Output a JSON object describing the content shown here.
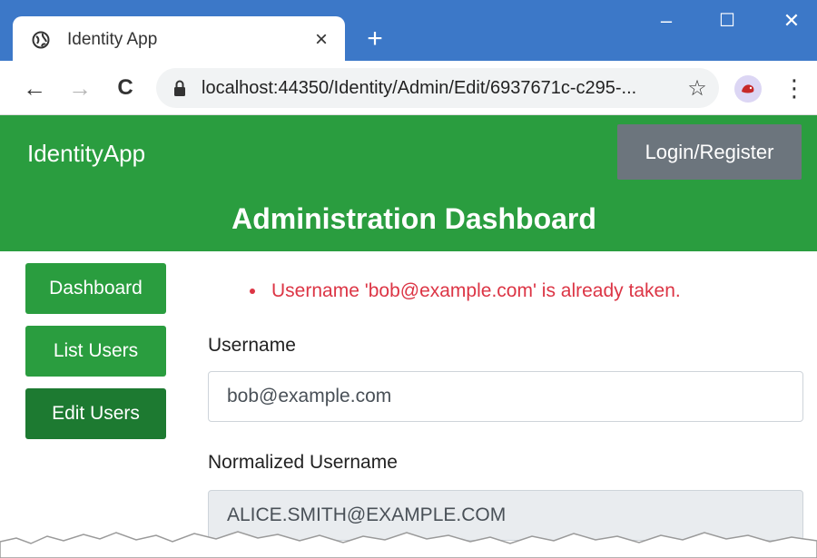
{
  "browser": {
    "tab_title": "Identity App",
    "tab_close": "×",
    "new_tab": "+",
    "minimize": "–",
    "maximize": "☐",
    "close": "✕",
    "back": "←",
    "forward": "→",
    "reload": "C",
    "url": "localhost:44350/Identity/Admin/Edit/6937671c-c295-...",
    "star": "☆",
    "menu": "⋮"
  },
  "navbar": {
    "brand": "IdentityApp",
    "login_label": "Login/Register",
    "page_title": "Administration Dashboard",
    "color": "#2a9d3f"
  },
  "sidebar": {
    "items": [
      {
        "label": "Dashboard",
        "active": false
      },
      {
        "label": "List Users",
        "active": false
      },
      {
        "label": "Edit Users",
        "active": true
      }
    ]
  },
  "form": {
    "errors": [
      "Username 'bob@example.com' is already taken."
    ],
    "username_label": "Username",
    "username_value": "bob@example.com",
    "normalized_label": "Normalized Username",
    "normalized_value": "ALICE.SMITH@EXAMPLE.COM"
  },
  "icons": [
    "globe-icon",
    "lock-icon",
    "star-icon",
    "profile-avatar-icon",
    "menu-icon"
  ]
}
